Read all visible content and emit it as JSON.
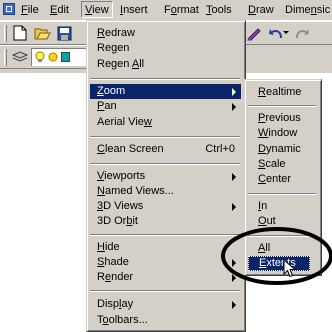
{
  "menubar": {
    "items": [
      {
        "pre": "",
        "u": "F",
        "post": "ile"
      },
      {
        "pre": "",
        "u": "E",
        "post": "dit"
      },
      {
        "pre": "",
        "u": "V",
        "post": "iew"
      },
      {
        "pre": "",
        "u": "I",
        "post": "nsert"
      },
      {
        "pre": "F",
        "u": "o",
        "post": "rmat"
      },
      {
        "pre": "",
        "u": "T",
        "post": "ools"
      },
      {
        "pre": "",
        "u": "D",
        "post": "raw"
      },
      {
        "pre": "Dime",
        "u": "n",
        "post": "sic"
      }
    ]
  },
  "toolbar": {
    "icons": [
      "new-icon",
      "open-icon",
      "save-icon",
      "pencil-icon",
      "undo-icon",
      "redo-icon",
      "layers-icon",
      "bulb-icon",
      "sun-icon"
    ]
  },
  "view_menu": {
    "items": [
      {
        "pre": "",
        "u": "R",
        "post": "edraw",
        "shortcut": "",
        "submenu": false
      },
      {
        "pre": "Re",
        "u": "g",
        "post": "en",
        "shortcut": "",
        "submenu": false
      },
      {
        "pre": "Regen ",
        "u": "A",
        "post": "ll",
        "shortcut": "",
        "submenu": false
      },
      {
        "pre": "",
        "u": "Z",
        "post": "oom",
        "shortcut": "",
        "submenu": true,
        "highlighted": true
      },
      {
        "pre": "",
        "u": "P",
        "post": "an",
        "shortcut": "",
        "submenu": true
      },
      {
        "pre": "Aerial Vie",
        "u": "w",
        "post": "",
        "shortcut": "",
        "submenu": false
      },
      {
        "pre": "",
        "u": "C",
        "post": "lean Screen",
        "shortcut": "Ctrl+0",
        "submenu": false
      },
      {
        "pre": "",
        "u": "V",
        "post": "iewports",
        "shortcut": "",
        "submenu": true
      },
      {
        "pre": "",
        "u": "N",
        "post": "amed Views...",
        "shortcut": "",
        "submenu": false
      },
      {
        "pre": "",
        "u": "3",
        "post": "D Views",
        "shortcut": "",
        "submenu": true
      },
      {
        "pre": "3D Or",
        "u": "b",
        "post": "it",
        "shortcut": "",
        "submenu": false
      },
      {
        "pre": "",
        "u": "H",
        "post": "ide",
        "shortcut": "",
        "submenu": false
      },
      {
        "pre": "",
        "u": "S",
        "post": "hade",
        "shortcut": "",
        "submenu": true
      },
      {
        "pre": "R",
        "u": "e",
        "post": "nder",
        "shortcut": "",
        "submenu": true
      },
      {
        "pre": "Disp",
        "u": "l",
        "post": "ay",
        "shortcut": "",
        "submenu": true
      },
      {
        "pre": "T",
        "u": "o",
        "post": "olbars...",
        "shortcut": "",
        "submenu": false
      }
    ]
  },
  "zoom_menu": {
    "items": [
      {
        "pre": "",
        "u": "R",
        "post": "ealtime"
      },
      {
        "pre": "",
        "u": "P",
        "post": "revious"
      },
      {
        "pre": "",
        "u": "W",
        "post": "indow"
      },
      {
        "pre": "",
        "u": "D",
        "post": "ynamic"
      },
      {
        "pre": "",
        "u": "S",
        "post": "cale"
      },
      {
        "pre": "",
        "u": "C",
        "post": "enter"
      },
      {
        "pre": "",
        "u": "I",
        "post": "n"
      },
      {
        "pre": "",
        "u": "O",
        "post": "ut"
      },
      {
        "pre": "",
        "u": "A",
        "post": "ll"
      },
      {
        "pre": "",
        "u": "E",
        "post": "xtents",
        "highlighted": true
      }
    ]
  },
  "colors": {
    "face": "#d4d0c8",
    "highlight": "#0a246a",
    "shadow": "#808080"
  }
}
